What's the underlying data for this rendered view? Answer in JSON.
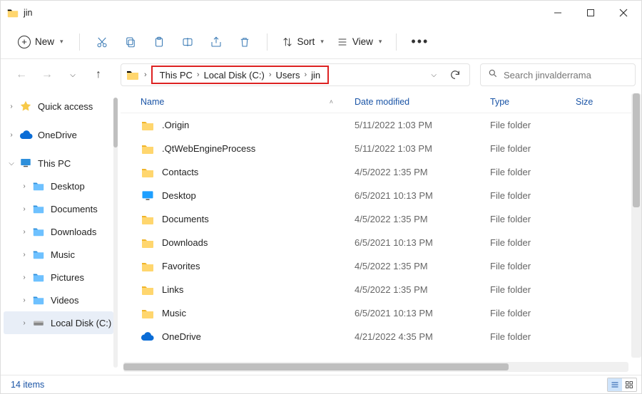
{
  "window": {
    "title": "jin"
  },
  "toolbar": {
    "new_label": "New",
    "sort_label": "Sort",
    "view_label": "View"
  },
  "nav": {
    "back_enabled": false,
    "forward_enabled": false
  },
  "breadcrumbs": [
    "This PC",
    "Local Disk (C:)",
    "Users",
    "jin"
  ],
  "search": {
    "placeholder": "Search jinvalderrama"
  },
  "sidebar": {
    "items": [
      {
        "label": "Quick access",
        "icon": "star",
        "twisty": ">",
        "depth": 0
      },
      {
        "label": "OneDrive",
        "icon": "cloud",
        "twisty": ">",
        "depth": 0
      },
      {
        "label": "This PC",
        "icon": "pc",
        "twisty": "v",
        "depth": 0
      },
      {
        "label": "Desktop",
        "icon": "folder-blue",
        "twisty": ">",
        "depth": 1
      },
      {
        "label": "Documents",
        "icon": "folder-blue",
        "twisty": ">",
        "depth": 1
      },
      {
        "label": "Downloads",
        "icon": "folder-blue",
        "twisty": ">",
        "depth": 1
      },
      {
        "label": "Music",
        "icon": "folder-blue",
        "twisty": ">",
        "depth": 1
      },
      {
        "label": "Pictures",
        "icon": "folder-blue",
        "twisty": ">",
        "depth": 1
      },
      {
        "label": "Videos",
        "icon": "folder-blue",
        "twisty": ">",
        "depth": 1
      },
      {
        "label": "Local Disk (C:)",
        "icon": "drive",
        "twisty": ">",
        "depth": 1,
        "selected": true
      }
    ]
  },
  "columns": {
    "name": "Name",
    "date": "Date modified",
    "type": "Type",
    "size": "Size"
  },
  "rows": [
    {
      "name": ".Origin",
      "date": "5/11/2022 1:03 PM",
      "type": "File folder",
      "icon": "folder"
    },
    {
      "name": ".QtWebEngineProcess",
      "date": "5/11/2022 1:03 PM",
      "type": "File folder",
      "icon": "folder"
    },
    {
      "name": "Contacts",
      "date": "4/5/2022 1:35 PM",
      "type": "File folder",
      "icon": "folder"
    },
    {
      "name": "Desktop",
      "date": "6/5/2021 10:13 PM",
      "type": "File folder",
      "icon": "desktop"
    },
    {
      "name": "Documents",
      "date": "4/5/2022 1:35 PM",
      "type": "File folder",
      "icon": "folder"
    },
    {
      "name": "Downloads",
      "date": "6/5/2021 10:13 PM",
      "type": "File folder",
      "icon": "folder"
    },
    {
      "name": "Favorites",
      "date": "4/5/2022 1:35 PM",
      "type": "File folder",
      "icon": "folder"
    },
    {
      "name": "Links",
      "date": "4/5/2022 1:35 PM",
      "type": "File folder",
      "icon": "folder"
    },
    {
      "name": "Music",
      "date": "6/5/2021 10:13 PM",
      "type": "File folder",
      "icon": "folder"
    },
    {
      "name": "OneDrive",
      "date": "4/21/2022 4:35 PM",
      "type": "File folder",
      "icon": "cloud"
    }
  ],
  "status": {
    "count_label": "14 items"
  }
}
